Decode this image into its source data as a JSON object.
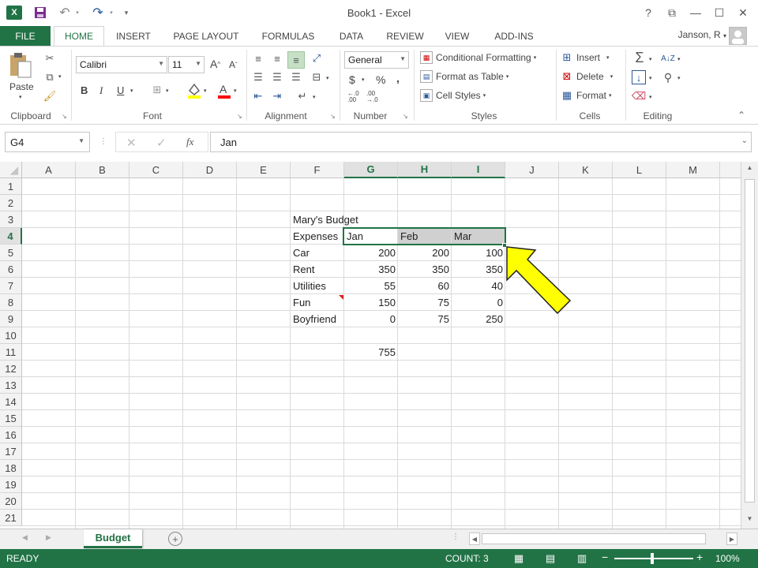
{
  "window": {
    "title": "Book1 - Excel",
    "help": "?",
    "restore_ribbon": "⧉",
    "minimize": "—",
    "maximize": "☐",
    "close": "✕"
  },
  "tabs": {
    "file": "FILE",
    "items": [
      "HOME",
      "INSERT",
      "PAGE LAYOUT",
      "FORMULAS",
      "DATA",
      "REVIEW",
      "VIEW",
      "ADD-INS"
    ],
    "active": "HOME"
  },
  "user": {
    "name": "Janson, R"
  },
  "ribbon": {
    "clipboard": {
      "label": "Clipboard",
      "paste": "Paste"
    },
    "font": {
      "label": "Font",
      "name": "Calibri",
      "size": "11",
      "bold": "B",
      "italic": "I",
      "underline": "U",
      "grow": "A",
      "shrink": "A"
    },
    "alignment": {
      "label": "Alignment"
    },
    "number": {
      "label": "Number",
      "format": "General",
      "currency": "$",
      "percent": "%",
      "comma": ","
    },
    "styles": {
      "label": "Styles",
      "conditional": "Conditional Formatting",
      "table": "Format as Table",
      "cell": "Cell Styles"
    },
    "cells": {
      "label": "Cells",
      "insert": "Insert",
      "delete": "Delete",
      "format": "Format"
    },
    "editing": {
      "label": "Editing"
    }
  },
  "formula_bar": {
    "name_box": "G4",
    "content": "Jan",
    "fx": "fx"
  },
  "columns": [
    "A",
    "B",
    "C",
    "D",
    "E",
    "F",
    "G",
    "H",
    "I",
    "J",
    "K",
    "L",
    "M"
  ],
  "rows": [
    "1",
    "2",
    "3",
    "4",
    "5",
    "6",
    "7",
    "8",
    "9",
    "10",
    "11",
    "12",
    "13",
    "14",
    "15",
    "16",
    "17",
    "18",
    "19",
    "20",
    "21"
  ],
  "cells": {
    "title": "Mary's Budget",
    "header": [
      "Expenses",
      "Jan",
      "Feb",
      "Mar"
    ],
    "data": [
      [
        "Car",
        "200",
        "200",
        "100"
      ],
      [
        "Rent",
        "350",
        "350",
        "350"
      ],
      [
        "Utilities",
        "55",
        "60",
        "40"
      ],
      [
        "Fun",
        "150",
        "75",
        "0"
      ],
      [
        "Boyfriend",
        "0",
        "75",
        "250"
      ]
    ],
    "total_jan": "755"
  },
  "sheets": {
    "active": "Budget"
  },
  "status": {
    "ready": "READY",
    "count": "COUNT: 3",
    "zoom": "100%"
  },
  "colors": {
    "excel_green": "#217346",
    "arrow_yellow": "#ffff00"
  }
}
